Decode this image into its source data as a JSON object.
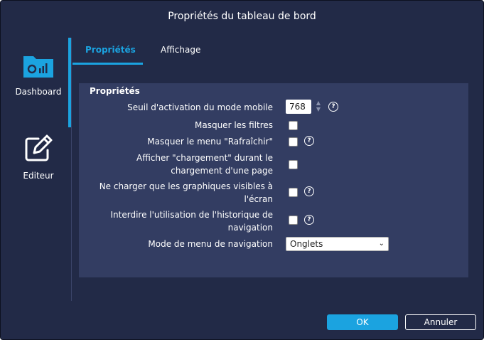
{
  "dialog": {
    "title": "Propriétés du tableau de bord"
  },
  "sidebar": {
    "items": [
      {
        "label": "Dashboard",
        "icon": "dashboard-icon"
      },
      {
        "label": "Editeur",
        "icon": "edit-icon"
      }
    ]
  },
  "tabs": [
    {
      "label": "Propriétés",
      "active": true
    },
    {
      "label": "Affichage",
      "active": false
    }
  ],
  "panel": {
    "title": "Propriétés",
    "mobile_threshold": {
      "label": "Seuil d'activation du mode mobile",
      "value": "768"
    },
    "hide_filters": {
      "label": "Masquer les filtres",
      "checked": false
    },
    "hide_refresh": {
      "label": "Masquer le menu \"Rafraîchir\"",
      "checked": false
    },
    "show_loading": {
      "label_line1": "Afficher \"chargement\" durant le",
      "label_line2": "chargement d'une page",
      "checked": false
    },
    "load_visible": {
      "label_line1": "Ne charger que les graphiques visibles à",
      "label_line2": "l'écran",
      "checked": false
    },
    "forbid_history": {
      "label_line1": "Interdire l'utilisation de l'historique de",
      "label_line2": "navigation",
      "checked": false
    },
    "nav_mode": {
      "label": "Mode de menu de navigation",
      "value": "Onglets"
    }
  },
  "help_glyph": "?",
  "buttons": {
    "ok": "OK",
    "cancel": "Annuler"
  },
  "colors": {
    "background": "#222a47",
    "panel": "#333d62",
    "accent": "#1ba3e0"
  }
}
